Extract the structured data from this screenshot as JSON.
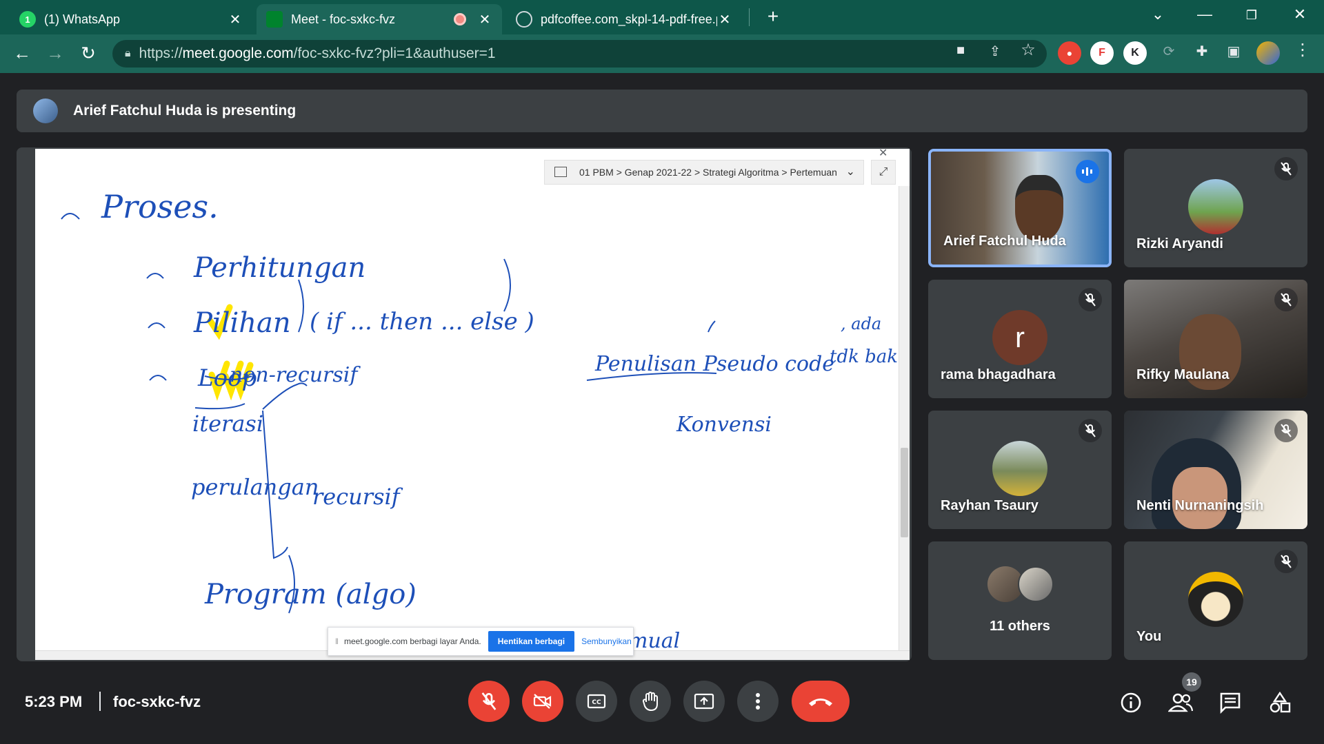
{
  "browser": {
    "tabs": [
      {
        "title": "(1) WhatsApp",
        "favicon": "1"
      },
      {
        "title": "Meet - foc-sxkc-fvz"
      },
      {
        "title": "pdfcoffee.com_skpl-14-pdf-free.p"
      }
    ],
    "new_tab": "+",
    "url_scheme": "https://",
    "url_host": "meet.google.com",
    "url_path": "/foc-sxkc-fvz?pli=1&authuser=1",
    "extensions": [
      "F",
      "K"
    ]
  },
  "banner": {
    "text": "Arief Fatchul Huda is presenting"
  },
  "shared_screen": {
    "breadcrumb": "01 PBM  >  Genap 2021-22  >  Strategi Algoritma  >  Pertemuan",
    "share_notice": "meet.google.com berbagi layar Anda.",
    "stop_sharing": "Hentikan berbagi",
    "hide": "Sembunyikan",
    "handwriting": {
      "proses": "Proses.",
      "perhitungan": "Perhitungan",
      "pilihan": "Pilihan",
      "if_then_else": "( if ... then ... else )",
      "loop": "Loop",
      "iterasi": "iterasi",
      "perulangan": "perulangan",
      "non_rekursif": "non-recursif",
      "rekursif": "recursif",
      "penulisan": "Penulisan Pseudo code",
      "titik_baku": "tdk baku",
      "ada": ", ada",
      "konvensi": "Konvensi",
      "program": "Program (algo)",
      "bottom_partial": "mual"
    }
  },
  "participants": [
    {
      "name": "Arief Fatchul Huda",
      "speaking": true
    },
    {
      "name": "Rizki Aryandi",
      "muted": true
    },
    {
      "name": "rama bhagadhara",
      "initial": "r",
      "muted": true
    },
    {
      "name": "Rifky Maulana",
      "muted": true
    },
    {
      "name": "Rayhan Tsaury",
      "muted": true
    },
    {
      "name": "Nenti Nurnaningsih",
      "muted": true
    },
    {
      "name": "11 others"
    },
    {
      "name": "You",
      "muted": true
    }
  ],
  "bottom_bar": {
    "time": "5:23 PM",
    "meeting_code": "foc-sxkc-fvz",
    "people_count": "19"
  },
  "colors": {
    "accent_red": "#ea4335",
    "speaking_border": "#8ab4f8",
    "tab_green": "#0e574a"
  }
}
